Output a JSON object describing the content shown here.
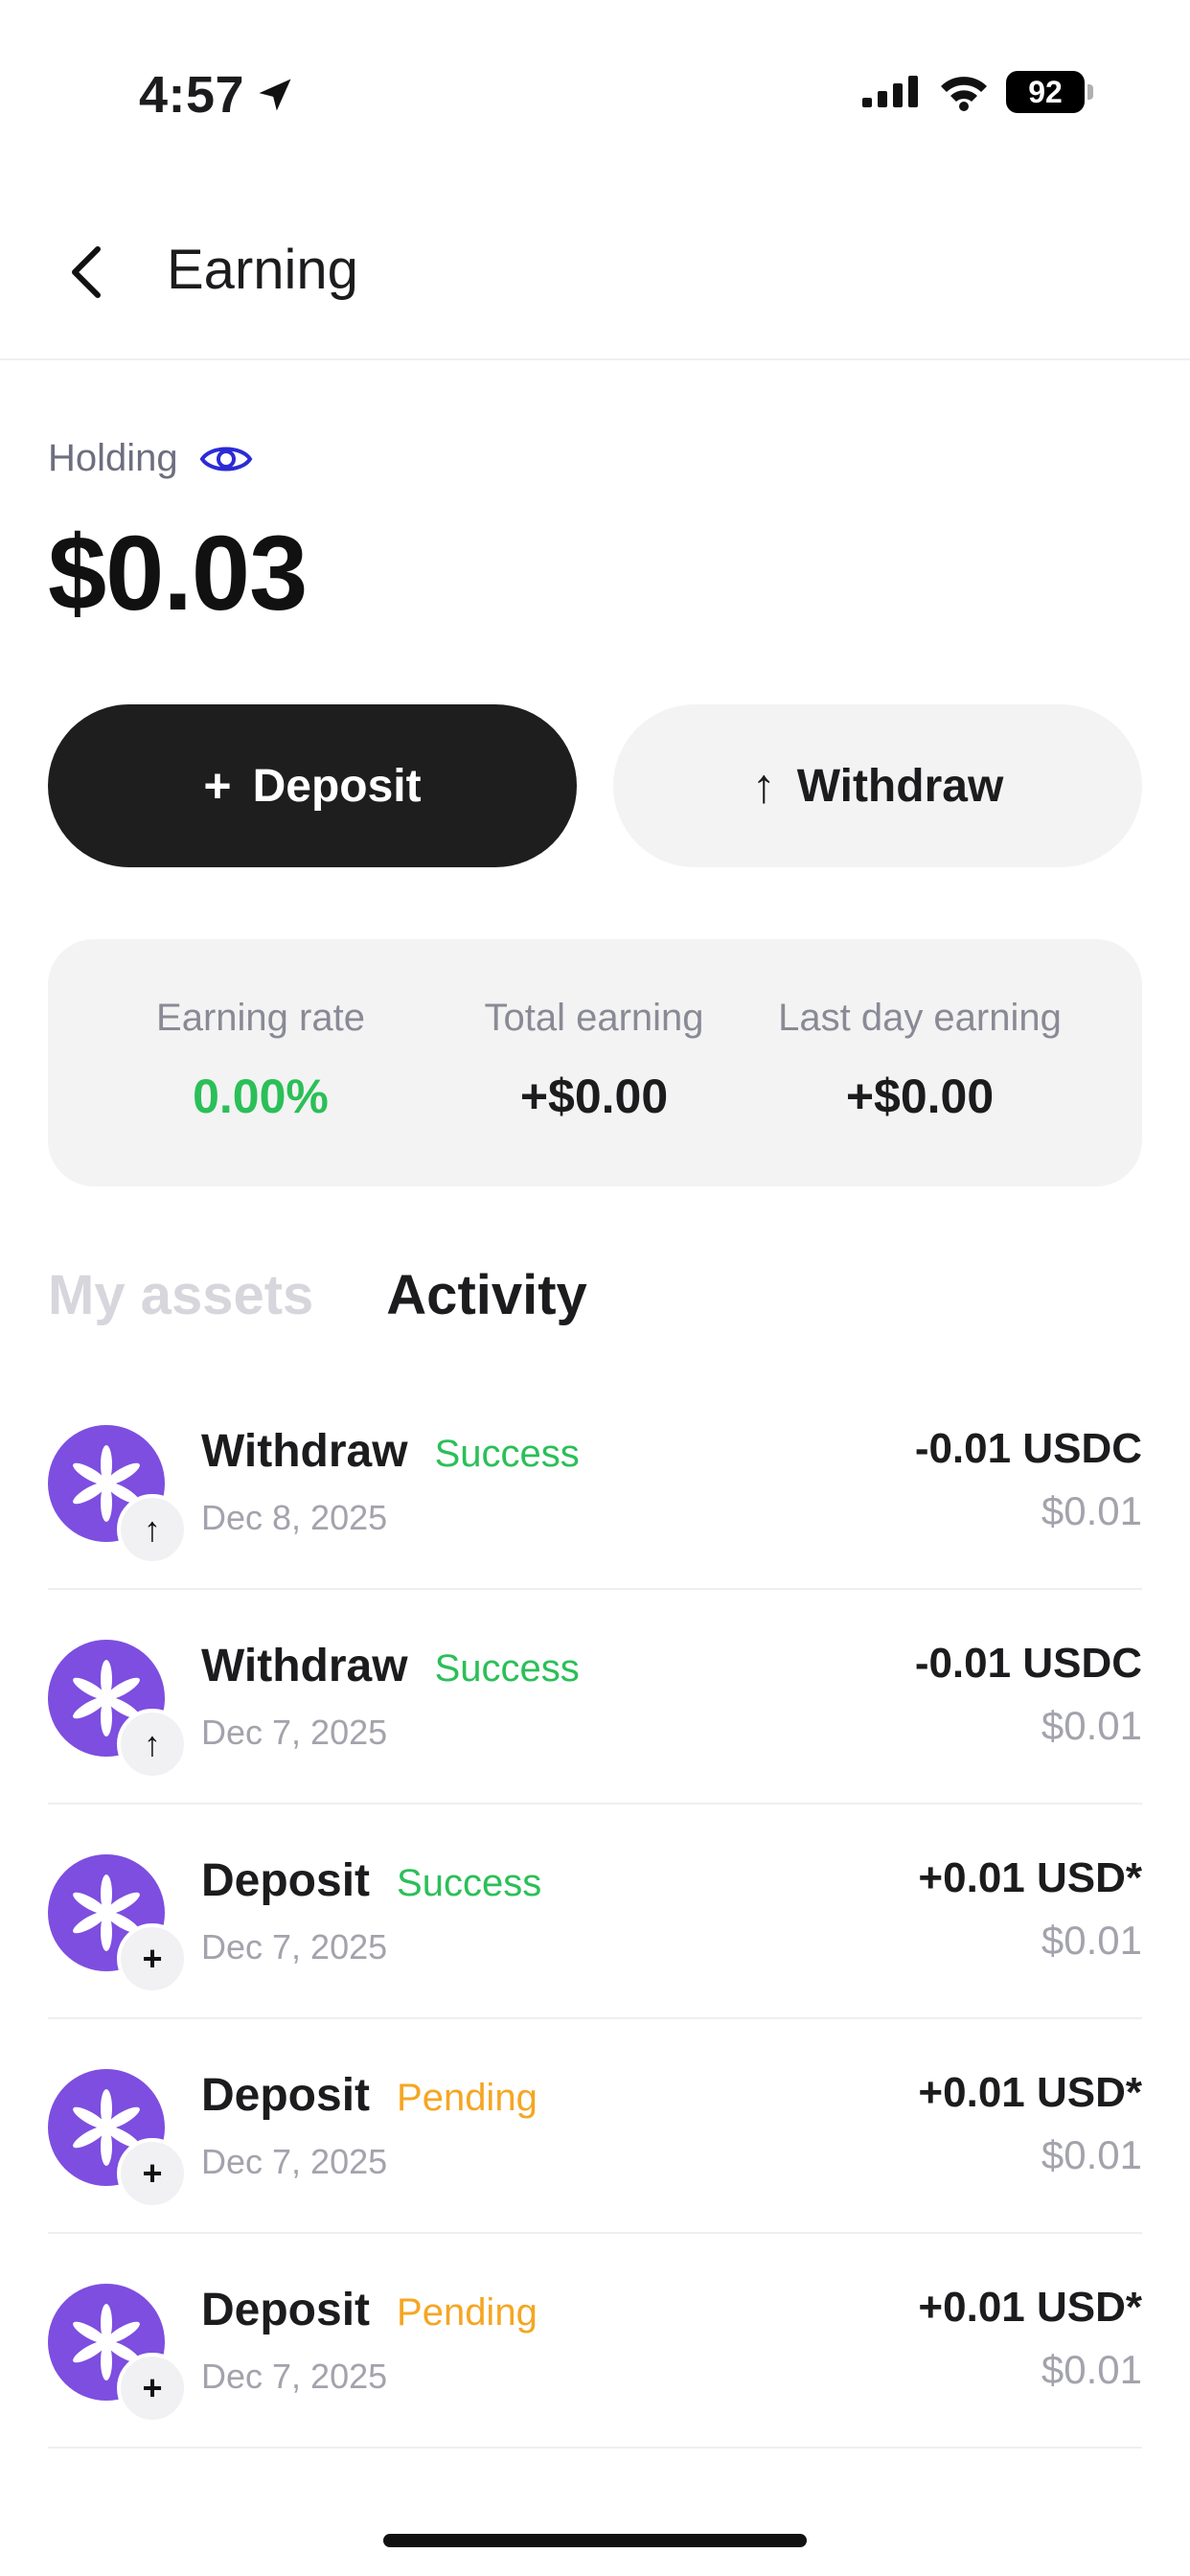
{
  "status_bar": {
    "time": "4:57",
    "battery": "92"
  },
  "header": {
    "title": "Earning",
    "back_icon": "chevron-left-icon"
  },
  "holding": {
    "label": "Holding",
    "visibility_icon": "eye-icon",
    "amount": "$0.03"
  },
  "actions": {
    "deposit_glyph": "+",
    "deposit_label": "Deposit",
    "withdraw_glyph": "↑",
    "withdraw_label": "Withdraw"
  },
  "stats": [
    {
      "label": "Earning rate",
      "value": "0.00%"
    },
    {
      "label": "Total earning",
      "value": "+$0.00"
    },
    {
      "label": "Last day earning",
      "value": "+$0.00"
    }
  ],
  "tabs": [
    {
      "label": "My assets",
      "active": false
    },
    {
      "label": "Activity",
      "active": true
    }
  ],
  "activity": [
    {
      "type": "Withdraw",
      "status": "Success",
      "date": "Dec 8, 2025",
      "amount": "-0.01 USDC",
      "fiat": "$0.01",
      "badge": "↑"
    },
    {
      "type": "Withdraw",
      "status": "Success",
      "date": "Dec 7, 2025",
      "amount": "-0.01 USDC",
      "fiat": "$0.01",
      "badge": "↑"
    },
    {
      "type": "Deposit",
      "status": "Success",
      "date": "Dec 7, 2025",
      "amount": "+0.01 USD*",
      "fiat": "$0.01",
      "badge": "+"
    },
    {
      "type": "Deposit",
      "status": "Pending",
      "date": "Dec 7, 2025",
      "amount": "+0.01 USD*",
      "fiat": "$0.01",
      "badge": "+"
    },
    {
      "type": "Deposit",
      "status": "Pending",
      "date": "Dec 7, 2025",
      "amount": "+0.01 USD*",
      "fiat": "$0.01",
      "badge": "+"
    }
  ],
  "colors": {
    "accent_purple": "#7d4ee0",
    "success_green": "#2bbf58",
    "pending_orange": "#f5a623",
    "primary_dark": "#1e1e1e"
  }
}
